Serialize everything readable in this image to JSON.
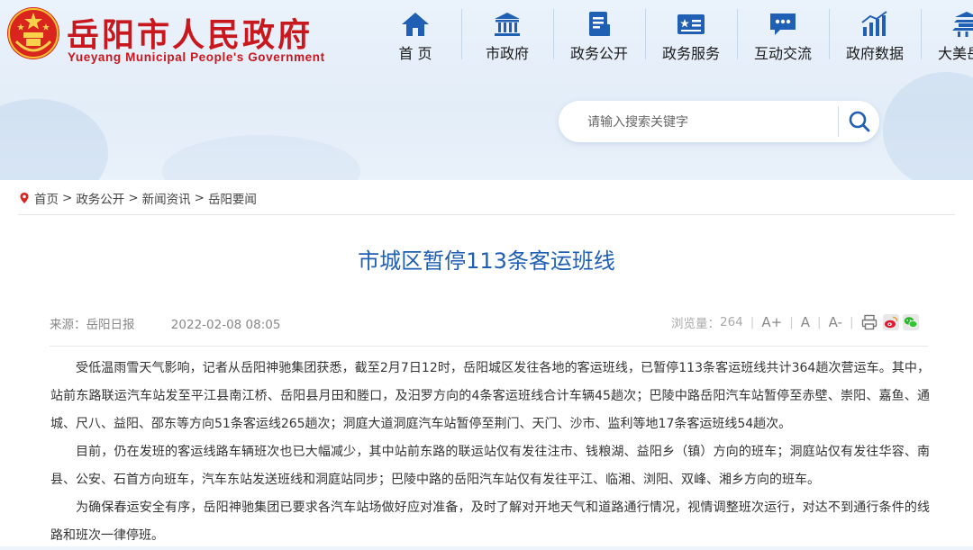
{
  "site": {
    "title": "岳阳市人民政府",
    "subtitle": "Yueyang Municipal People's Government",
    "brand_color": "#c9171e"
  },
  "nav": {
    "items": [
      {
        "label": "首 页",
        "icon": "home-icon"
      },
      {
        "label": "市政府",
        "icon": "government-building-icon"
      },
      {
        "label": "政务公开",
        "icon": "document-icon"
      },
      {
        "label": "政务服务",
        "icon": "service-card-icon"
      },
      {
        "label": "互动交流",
        "icon": "chat-icon"
      },
      {
        "label": "政府数据",
        "icon": "chart-icon"
      },
      {
        "label": "大美岳阳",
        "icon": "pavilion-icon"
      }
    ],
    "icon_color": "#1f5fb4"
  },
  "search": {
    "placeholder": "请输入搜索关键字",
    "icon": "search-icon"
  },
  "breadcrumb": {
    "items": [
      "首页",
      "政务公开",
      "新闻资讯",
      "岳阳要闻"
    ],
    "separator": ">"
  },
  "article": {
    "title": "市城区暂停113条客运班线",
    "source_label": "来源：",
    "source": "岳阳日报",
    "date": "2022-02-08 08:05",
    "views_label": "浏览量：",
    "views": "264",
    "font_increase": "A+",
    "font_normal": "A",
    "font_decrease": "A-",
    "share_icons": [
      "print-icon",
      "weibo-icon",
      "wechat-icon"
    ],
    "paragraphs": [
      "受低温雨雪天气影响，记者从岳阳神驰集团获悉，截至2月7日12时，岳阳城区发往各地的客运班线，已暂停113条客运班线共计364趟次营运车。其中，站前东路联运汽车站发至平江县南江桥、岳阳县月田和塍口，及汨罗方向的4条客运班线合计车辆45趟次；巴陵中路岳阳汽车站暂停至赤壁、崇阳、嘉鱼、通城、尺八、益阳、邵东等方向51条客运线265趟次；洞庭大道洞庭汽车站暂停至荆门、天门、沙市、监利等地17条客运班线54趟次。",
      "目前，仍在发班的客运线路车辆班次也已大幅减少，其中站前东路的联运站仅有发往注市、钱粮湖、益阳乡（镇）方向的班车；洞庭站仅有发往华容、南县、公安、石首方向班车，汽车东站发送班线和洞庭站同步；巴陵中路的岳阳汽车站仅有发往平江、临湘、浏阳、双峰、湘乡方向的班车。",
      "为确保春运安全有序，岳阳神驰集团已要求各汽车站场做好应对准备，及时了解对开地天气和道路通行情况，视情调整班次运行，对达不到通行条件的线路和班次一律停班。"
    ],
    "title_color": "#1f5fb4"
  }
}
